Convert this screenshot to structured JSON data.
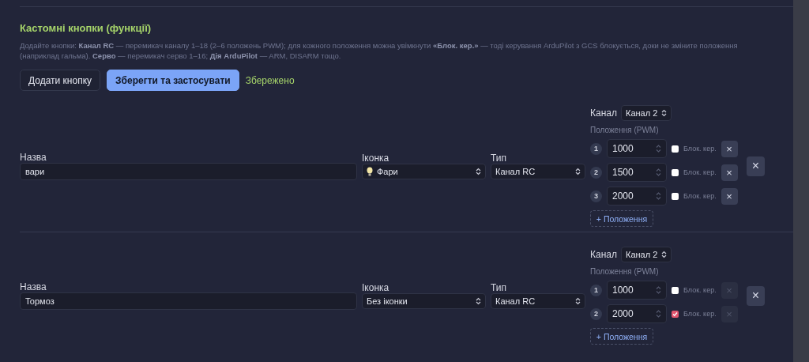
{
  "section": {
    "title": "Кастомні кнопки (функції)",
    "description": "Додайте кнопки: **Канал RC** — перемикач каналу 1–18 (2–6 положень PWM); для кожного положення можна увімкнути **«Блок. кер.»** — тоді керування ArduPilot з GCS блокується, доки не зміните положення (наприклад гальма). **Серво** — перемикач серво 1–16; **Дія ArduPilot** — ARM, DISARM тощо.",
    "add_button": "Додати кнопку",
    "save_button": "Зберегти та застосувати",
    "status": "Збережено"
  },
  "buttons": [
    {
      "name_label": "Назва",
      "name": "вари",
      "icon_label": "Іконка",
      "icon": {
        "kind": "bulb",
        "label": "Фари"
      },
      "type_label": "Тип",
      "type": "Канал RC",
      "channel_label": "Канал",
      "channel": "Канал 2",
      "positions_label": "Положення (PWM)",
      "add_position": "+ Положення",
      "remove": "×",
      "positions": [
        {
          "index": "1",
          "pwm": "1000",
          "lock_label": "Блок. кер.",
          "lock": false,
          "remove": "×",
          "remove_disabled": false
        },
        {
          "index": "2",
          "pwm": "1500",
          "lock_label": "Блок. кер.",
          "lock": false,
          "remove": "×",
          "remove_disabled": false
        },
        {
          "index": "3",
          "pwm": "2000",
          "lock_label": "Блок. кер.",
          "lock": false,
          "remove": "×",
          "remove_disabled": false
        }
      ]
    },
    {
      "name_label": "Назва",
      "name": "Тормоз",
      "icon_label": "Іконка",
      "icon": {
        "kind": "none",
        "label": "Без іконки"
      },
      "type_label": "Тип",
      "type": "Канал RC",
      "channel_label": "Канал",
      "channel": "Канал 2",
      "positions_label": "Положення (PWM)",
      "add_position": "+ Положення",
      "remove": "×",
      "positions": [
        {
          "index": "1",
          "pwm": "1000",
          "lock_label": "Блок. кер.",
          "lock": false,
          "remove": "×",
          "remove_disabled": true
        },
        {
          "index": "2",
          "pwm": "2000",
          "lock_label": "Блок. кер.",
          "lock": true,
          "remove": "×",
          "remove_disabled": true
        }
      ]
    }
  ]
}
